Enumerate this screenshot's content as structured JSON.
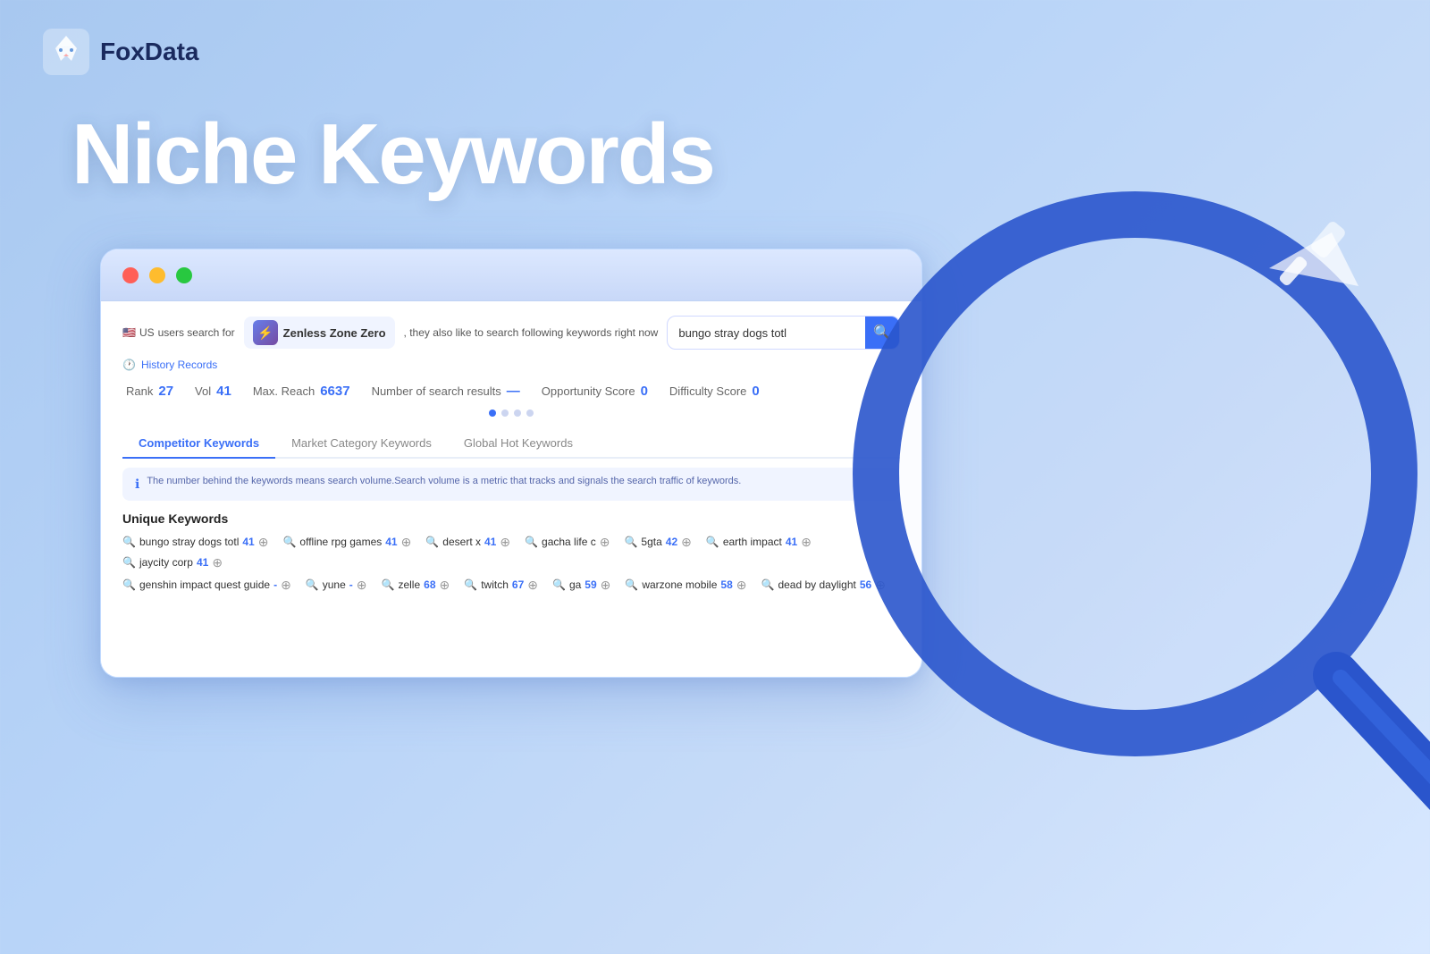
{
  "logo": {
    "brand": "FoxData"
  },
  "hero": {
    "title": "Niche Keywords"
  },
  "browser": {
    "titlebar": {
      "dots": [
        "red",
        "yellow",
        "green"
      ]
    },
    "header": {
      "flag_emoji": "🇺🇸",
      "country": "US",
      "prefix_text": "users search for",
      "app_name": "Zenless Zone Zero",
      "suffix_text": ", they also like to search following keywords right now",
      "search_placeholder": "bungo stray dogs totl",
      "search_btn_icon": "🔍",
      "history_icon": "🕐",
      "history_label": "History Records"
    },
    "stats": [
      {
        "label": "Rank",
        "value": "27"
      },
      {
        "label": "Vol",
        "value": "41"
      },
      {
        "label": "Max. Reach",
        "value": "6637"
      },
      {
        "label": "Number of search results",
        "value": "..."
      },
      {
        "label": "Opportunity Score",
        "value": "0"
      },
      {
        "label": "Difficulty Score",
        "value": "0"
      }
    ],
    "tabs": [
      {
        "label": "Competitor Keywords",
        "active": true
      },
      {
        "label": "Market Category Keywords",
        "active": false
      },
      {
        "label": "Global Hot Keywords",
        "active": false
      }
    ],
    "info_text": "The number behind the keywords means search volume.Search volume is a metric that tracks and signals the search traffic of keywords.",
    "section_unique": "Unique Keywords",
    "keywords_row1": [
      {
        "text": "bungo stray dogs totl",
        "num": "41"
      },
      {
        "text": "offline rpg games",
        "num": "41"
      },
      {
        "text": "desert x",
        "num": "41"
      },
      {
        "text": "gacha life c",
        "num": ""
      },
      {
        "text": "5gta",
        "num": "42"
      },
      {
        "text": "earth impact",
        "num": "41"
      },
      {
        "text": "jaycity corp",
        "num": "41"
      }
    ],
    "keywords_row2": [
      {
        "text": "genshin impact quest guide",
        "num": "-"
      },
      {
        "text": "yune",
        "num": "-"
      },
      {
        "text": "zelle",
        "num": "68"
      },
      {
        "text": "twitch",
        "num": "67"
      },
      {
        "text": "ga",
        "num": "59"
      },
      {
        "text": "warzone mobile",
        "num": "58"
      },
      {
        "text": "dead by daylight",
        "num": "56"
      }
    ]
  }
}
